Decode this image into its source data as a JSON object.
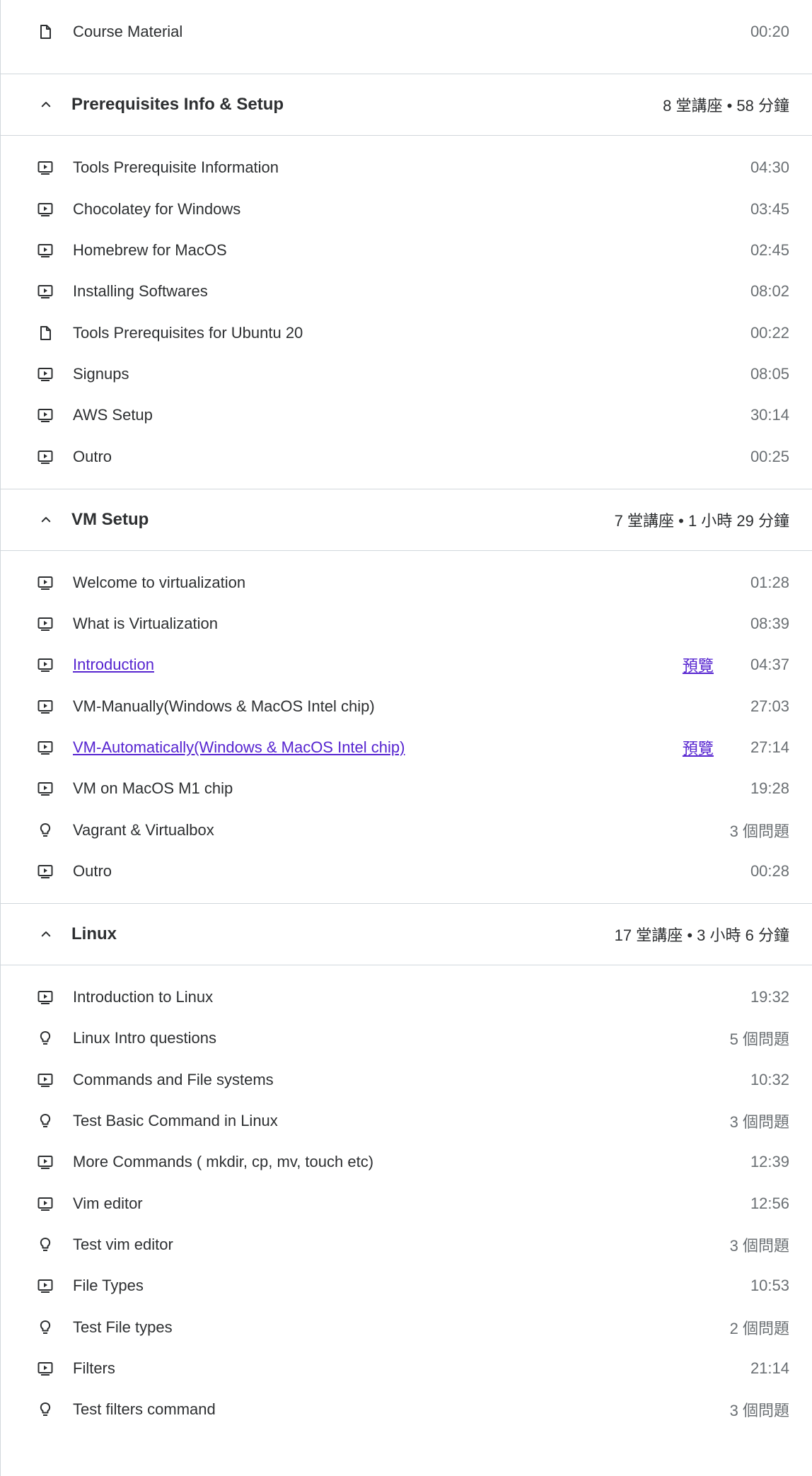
{
  "top_items": [
    {
      "icon": "file-icon",
      "title": "Course Material",
      "meta": "00:20"
    }
  ],
  "sections": [
    {
      "title": "Prerequisites Info & Setup",
      "meta": "8 堂講座 • 58 分鐘",
      "items": [
        {
          "icon": "video-icon",
          "title": "Tools Prerequisite Information",
          "meta": "04:30"
        },
        {
          "icon": "video-icon",
          "title": "Chocolatey for Windows",
          "meta": "03:45"
        },
        {
          "icon": "video-icon",
          "title": "Homebrew for MacOS",
          "meta": "02:45"
        },
        {
          "icon": "video-icon",
          "title": "Installing Softwares",
          "meta": "08:02"
        },
        {
          "icon": "file-icon",
          "title": "Tools Prerequisites for Ubuntu 20",
          "meta": "00:22"
        },
        {
          "icon": "video-icon",
          "title": "Signups",
          "meta": "08:05"
        },
        {
          "icon": "video-icon",
          "title": "AWS Setup",
          "meta": "30:14"
        },
        {
          "icon": "video-icon",
          "title": "Outro",
          "meta": "00:25"
        }
      ]
    },
    {
      "title": "VM Setup",
      "meta": "7 堂講座 • 1 小時 29 分鐘",
      "items": [
        {
          "icon": "video-icon",
          "title": "Welcome to virtualization",
          "meta": "01:28"
        },
        {
          "icon": "video-icon",
          "title": "What is Virtualization",
          "meta": "08:39"
        },
        {
          "icon": "video-icon",
          "title": "Introduction",
          "meta": "04:37",
          "link": true,
          "preview": "預覽"
        },
        {
          "icon": "video-icon",
          "title": "VM-Manually(Windows & MacOS Intel chip)",
          "meta": "27:03"
        },
        {
          "icon": "video-icon",
          "title": "VM-Automatically(Windows & MacOS Intel chip)",
          "meta": "27:14",
          "link": true,
          "preview": "預覽"
        },
        {
          "icon": "video-icon",
          "title": "VM on MacOS M1 chip",
          "meta": "19:28"
        },
        {
          "icon": "quiz-icon",
          "title": "Vagrant & Virtualbox",
          "meta": "3 個問題"
        },
        {
          "icon": "video-icon",
          "title": "Outro",
          "meta": "00:28"
        }
      ]
    },
    {
      "title": "Linux",
      "meta": "17 堂講座 • 3 小時 6 分鐘",
      "items": [
        {
          "icon": "video-icon",
          "title": "Introduction to Linux",
          "meta": "19:32"
        },
        {
          "icon": "quiz-icon",
          "title": "Linux Intro questions",
          "meta": "5 個問題"
        },
        {
          "icon": "video-icon",
          "title": "Commands and File systems",
          "meta": "10:32"
        },
        {
          "icon": "quiz-icon",
          "title": "Test Basic Command in Linux",
          "meta": "3 個問題"
        },
        {
          "icon": "video-icon",
          "title": "More Commands ( mkdir, cp, mv, touch etc)",
          "meta": "12:39"
        },
        {
          "icon": "video-icon",
          "title": "Vim editor",
          "meta": "12:56"
        },
        {
          "icon": "quiz-icon",
          "title": "Test vim editor",
          "meta": "3 個問題"
        },
        {
          "icon": "video-icon",
          "title": "File Types",
          "meta": "10:53"
        },
        {
          "icon": "quiz-icon",
          "title": "Test File types",
          "meta": "2 個問題"
        },
        {
          "icon": "video-icon",
          "title": "Filters",
          "meta": "21:14"
        },
        {
          "icon": "quiz-icon",
          "title": "Test filters command",
          "meta": "3 個問題"
        }
      ]
    }
  ]
}
